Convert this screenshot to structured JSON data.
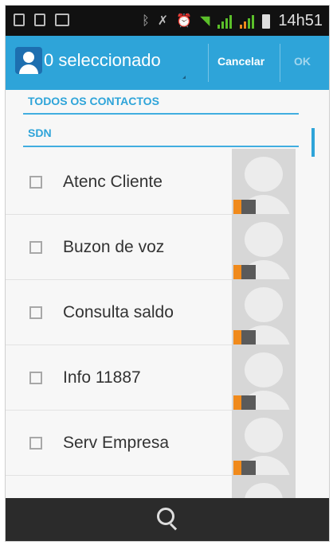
{
  "status_bar": {
    "time": "14h51"
  },
  "action_bar": {
    "title": "0 seleccionado",
    "cancel_label": "Cancelar",
    "ok_label": "OK"
  },
  "sections": {
    "all_contacts": "TODOS OS CONTACTOS",
    "sdn": "SDN"
  },
  "contacts": [
    {
      "name": "Atenc Cliente",
      "checked": false
    },
    {
      "name": "Buzon de voz",
      "checked": false
    },
    {
      "name": "Consulta saldo",
      "checked": false
    },
    {
      "name": "Info 11887",
      "checked": false
    },
    {
      "name": "Serv Empresa",
      "checked": false
    }
  ],
  "colors": {
    "accent": "#2ea4d9",
    "status_bar": "#111111",
    "bottom_bar": "#2b2b2b",
    "sim_badge": "#f08a1c"
  }
}
